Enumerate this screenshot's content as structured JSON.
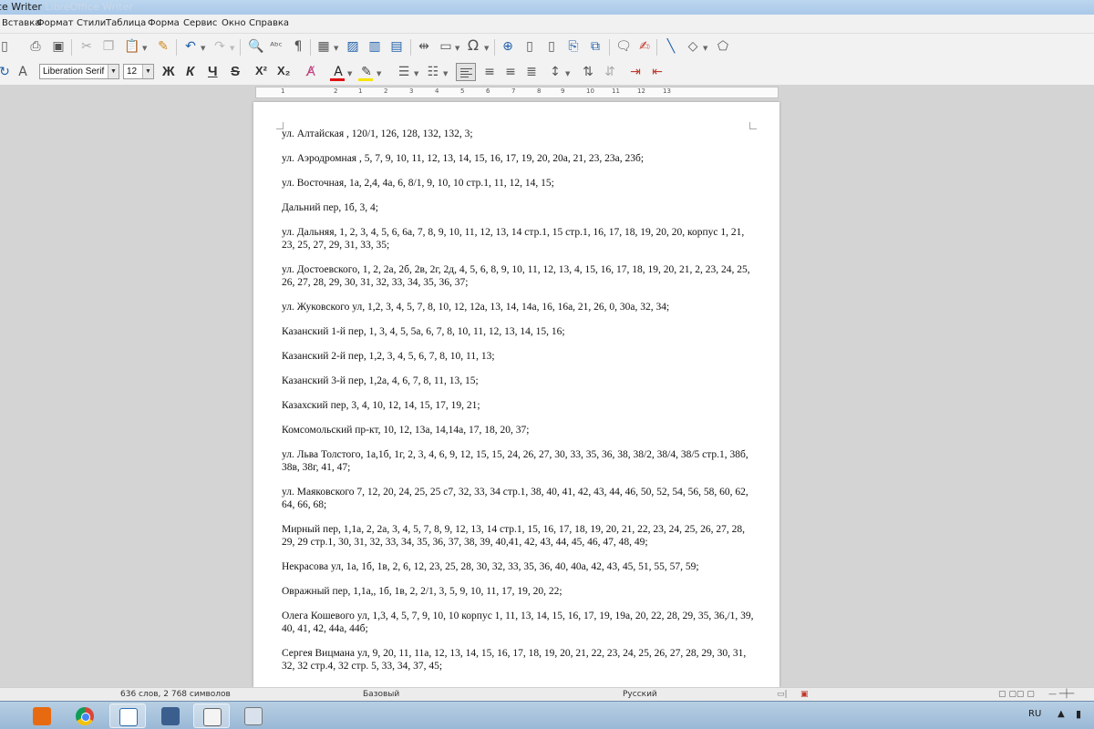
{
  "window": {
    "title_visible": "ce Writer",
    "title_faded": "LibreOffice Writer"
  },
  "menu": [
    "Вставка",
    "Формат",
    "Стили",
    "Таблица",
    "Форма",
    "Сервис",
    "Окно",
    "Справка"
  ],
  "toolbar_format": {
    "font_name": "Liberation Serif",
    "font_size": "12",
    "bold": "Ж",
    "italic": "К",
    "underline": "Ч",
    "strike": "S",
    "superscript": "X²",
    "subscript": "X₂"
  },
  "ruler": {
    "numbers": [
      "1",
      "2",
      "1",
      "2",
      "3",
      "4",
      "5",
      "6",
      "7",
      "8",
      "9",
      "10",
      "11",
      "12",
      "13"
    ]
  },
  "document": {
    "paragraphs": [
      "ул. Алтайская , 120/1, 126, 128, 132, 132, 3;",
      "ул. Аэродромная , 5, 7, 9, 10, 11, 12, 13, 14, 15, 16, 17, 19, 20, 20а, 21, 23, 23а, 23б;",
      "ул. Восточная, 1а, 2,4, 4а, 6, 8/1, 9, 10, 10 стр.1, 11, 12, 14, 15;",
      "Дальний пер, 1б, 3, 4;",
      "ул. Дальняя, 1, 2, 3, 4, 5, 6, 6а, 7, 8, 9, 10, 11, 12, 13, 14 стр.1, 15 стр.1, 16, 17, 18, 19, 20, 20, корпус 1, 21, 23, 25, 27, 29, 31, 33, 35;",
      "ул. Достоевского, 1, 2, 2а, 2б, 2в, 2г, 2д, 4, 5, 6, 8, 9, 10, 11, 12, 13, 4, 15, 16, 17, 18, 19, 20, 21, 2, 23, 24, 25, 26, 27, 28, 29, 30, 31, 32, 33, 34, 35, 36, 37;",
      "ул. Жуковского ул, 1,2, 3, 4, 5, 7, 8, 10, 12, 12а, 13, 14, 14а, 16, 16а, 21, 26, 0, 30а, 32, 34;",
      "Казанский 1-й пер, 1, 3, 4, 5, 5а, 6, 7, 8, 10, 11, 12, 13, 14, 15, 16;",
      "Казанский 2-й пер, 1,2, 3, 4, 5, 6, 7, 8, 10, 11, 13;",
      "Казанский 3-й пер, 1,2а, 4, 6, 7, 8, 11, 13, 15;",
      "Казахский пер, 3, 4, 10, 12, 14, 15, 17, 19, 21;",
      "Комсомольский пр-кт, 10, 12, 13а, 14,14а, 17, 18, 20, 37;",
      "ул. Льва Толстого, 1а,1б, 1г, 2, 3, 4, 6, 9, 12, 15, 15, 24, 26, 27, 30, 33, 35, 36, 38, 38/2, 38/4, 38/5 стр.1, 38б, 38в, 38г, 41, 47;",
      "ул. Маяковского 7, 12, 20, 24, 25, 25 с7, 32, 33, 34 стр.1, 38, 40, 41, 42, 43, 44, 46, 50, 52, 54, 56, 58, 60, 62, 64, 66, 68;",
      "Мирный пер, 1,1а, 2, 2а, 3, 4, 5, 7, 8, 9, 12, 13, 14 стр.1, 15, 16, 17, 18, 19, 20, 21, 22, 23, 24, 25, 26, 27, 28, 29, 29 стр.1, 30, 31, 32, 33, 34, 35, 36, 37, 38, 39, 40,41, 42, 43, 44, 45, 46, 47, 48, 49;",
      "Некрасова ул, 1а, 1б, 1в, 2, 6, 12, 23, 25, 28, 30, 32, 33, 35, 36, 40, 40а, 42, 43, 45, 51, 55, 57, 59;",
      "Овражный пер, 1,1а,, 1б, 1в, 2, 2/1, 3, 5, 9, 10, 11, 17, 19, 20, 22;",
      "Олега Кошевого ул, 1,3, 4, 5, 7, 9, 10, 10 корпус 1, 11, 13, 14, 15, 16, 17, 19, 19а, 20, 22, 28, 29, 35, 36,/1, 39, 40, 41, 42, 44а, 44б;",
      "Сергея Вицмана ул, 9, 20, 11, 11а, 12, 13, 14, 15, 16, 17, 18, 19, 20, 21, 22, 23, 24, 25, 26, 27, 28, 29, 30, 31, 32, 32 стр.4, 32 стр. 5, 33, 34, 37, 45;"
    ]
  },
  "statusbar": {
    "word_count": "636 слов, 2 768 символов",
    "page_style": "Базовый",
    "language": "Русский"
  },
  "taskbar": {
    "lang": "RU"
  }
}
